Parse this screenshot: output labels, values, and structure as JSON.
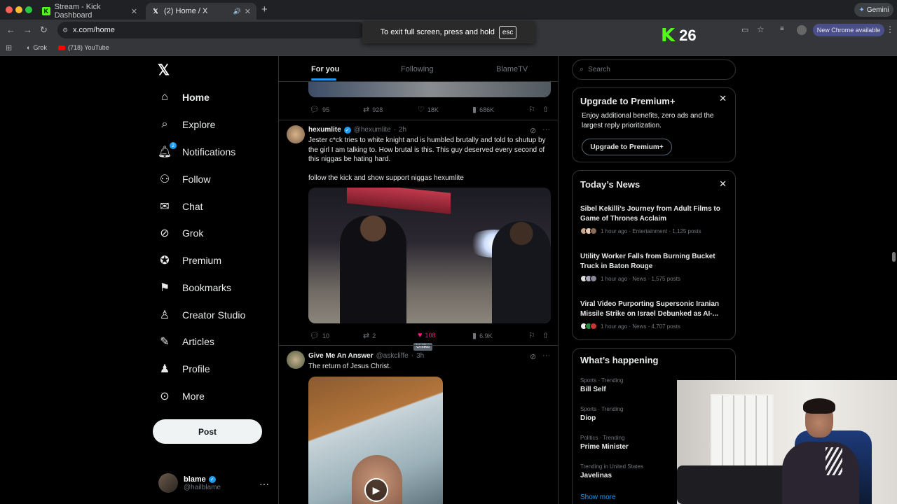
{
  "browser": {
    "tabs": [
      {
        "title": "Stream - Kick Dashboard",
        "active": false
      },
      {
        "title": "(2) Home / X",
        "active": true
      }
    ],
    "url": "x.com/home",
    "bookmarks": [
      {
        "label": "Grok"
      },
      {
        "label": "(718) YouTube"
      }
    ],
    "gemini_label": "Gemini",
    "new_chrome_label": "New Chrome available",
    "fullscreen_notice": "To exit full screen, press and hold",
    "esc_key": "esc"
  },
  "overlay": {
    "kick_count": "26",
    "kick_color": "#53fc18"
  },
  "sidebar": {
    "logo": "X",
    "items": [
      {
        "label": "Home",
        "icon": "home-icon"
      },
      {
        "label": "Explore",
        "icon": "search-icon"
      },
      {
        "label": "Notifications",
        "icon": "bell-icon",
        "badge": "2"
      },
      {
        "label": "Follow",
        "icon": "follow-icon"
      },
      {
        "label": "Chat",
        "icon": "mail-icon"
      },
      {
        "label": "Grok",
        "icon": "grok-icon"
      },
      {
        "label": "Premium",
        "icon": "premium-icon"
      },
      {
        "label": "Bookmarks",
        "icon": "bookmark-icon"
      },
      {
        "label": "Creator Studio",
        "icon": "creator-studio-icon"
      },
      {
        "label": "Articles",
        "icon": "articles-icon"
      },
      {
        "label": "Profile",
        "icon": "profile-icon"
      },
      {
        "label": "More",
        "icon": "more-icon"
      }
    ],
    "post_label": "Post",
    "account": {
      "name": "blame",
      "handle": "@hailblame"
    }
  },
  "feed": {
    "tabs": [
      "For you",
      "Following",
      "BlameTV"
    ],
    "prev_tweet_actions": {
      "replies": "95",
      "reposts": "928",
      "likes": "18K",
      "views": "686K"
    },
    "tweets": [
      {
        "name": "hexumlite",
        "handle": "@hexumlite",
        "time": "2h",
        "text": "Jester c*ck tries to white knight and is humbled brutally and told to shutup by the girl I am talking to. How brutal is this. This guy deserved every second of this niggas be hating hard.",
        "text2": "follow the kick and show support niggas hexumlite",
        "replies": "10",
        "reposts": "2",
        "likes": "108",
        "views": "6.9K",
        "tooltip": "Unlike"
      },
      {
        "name": "Give Me An Answer",
        "handle": "@askcliffe",
        "time": "3h",
        "text": "The return of Jesus Christ."
      }
    ]
  },
  "right": {
    "search_placeholder": "Search",
    "premium": {
      "title": "Upgrade to Premium+",
      "desc": "Enjoy additional benefits, zero ads and the largest reply prioritization.",
      "button": "Upgrade to Premium+"
    },
    "news": {
      "title": "Today’s News",
      "items": [
        {
          "title": "Sibel Kekilli’s Journey from Adult Films to Game of Thrones Acclaim",
          "meta": "1 hour ago · Entertainment · 1,125 posts"
        },
        {
          "title": "Utility Worker Falls from Burning Bucket Truck in Baton Rouge",
          "meta": "1 hour ago · News · 1,575 posts"
        },
        {
          "title": "Viral Video Purporting Supersonic Iranian Missile Strike on Israel Debunked as AI-...",
          "meta": "1 hour ago · News · 4,707 posts"
        }
      ]
    },
    "happening": {
      "title": "What’s happening",
      "items": [
        {
          "cat": "Sports · Trending",
          "name": "Bill Self"
        },
        {
          "cat": "Sports · Trending",
          "name": "Diop"
        },
        {
          "cat": "Politics · Trending",
          "name": "Prime Minister"
        },
        {
          "cat": "Trending in United States",
          "name": "Javelinas"
        }
      ],
      "show_more": "Show more"
    }
  }
}
